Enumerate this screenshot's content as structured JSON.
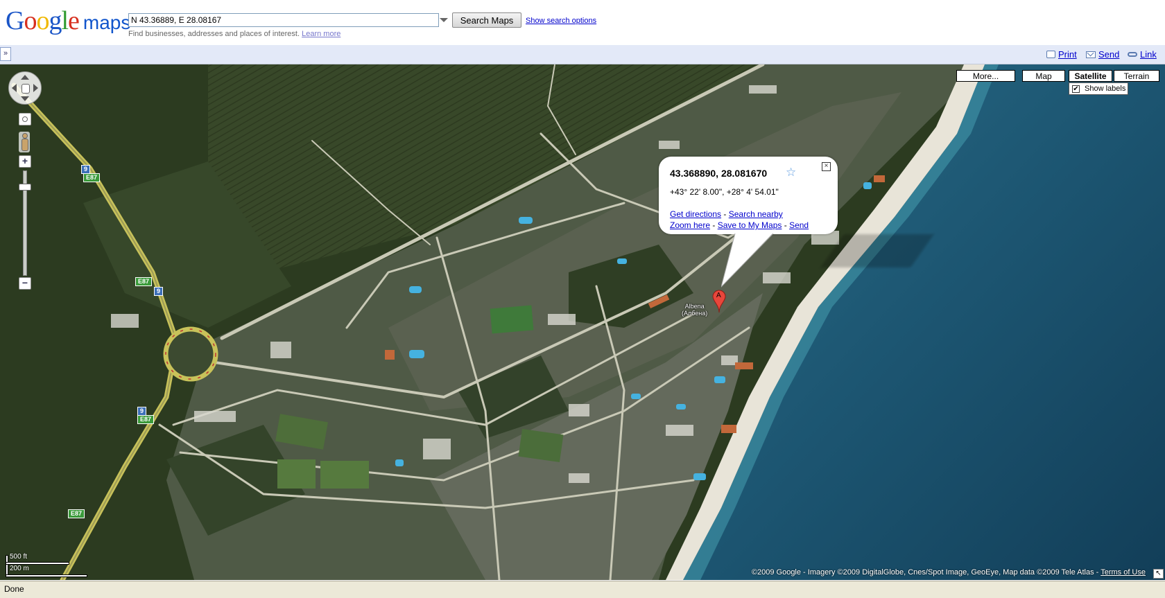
{
  "header": {
    "logo_google": "Google",
    "logo_maps": "maps",
    "search_value": "N 43.36889, E 28.08167",
    "search_button": "Search Maps",
    "search_options_link": "Show search options",
    "hint_text": "Find businesses, addresses and places of interest.",
    "hint_link": "Learn more"
  },
  "toolbar": {
    "panel_toggle": "»",
    "print": "Print",
    "send": "Send",
    "link": "Link"
  },
  "maptype": {
    "more": "More...",
    "map": "Map",
    "satellite": "Satellite",
    "terrain": "Terrain",
    "active": "Satellite",
    "labels_check": "✔",
    "labels_text": "Show labels",
    "labels_checked": true
  },
  "info_window": {
    "title": "43.368890, 28.081670",
    "star": "☆",
    "close": "×",
    "dms": "+43° 22' 8.00\", +28° 4' 54.01\"",
    "get_directions": "Get directions",
    "search_nearby": "Search nearby",
    "zoom_here": "Zoom here",
    "save_to_my_maps": "Save to My Maps",
    "send": "Send",
    "separator": " - "
  },
  "marker": {
    "label": "A",
    "color": "#e8463b"
  },
  "poi": {
    "name_line1": "Albena",
    "name_line2": "(Албена)"
  },
  "shields": [
    {
      "text": "9",
      "type": "b"
    },
    {
      "text": "E87",
      "type": "g"
    },
    {
      "text": "E87",
      "type": "g"
    },
    {
      "text": "9",
      "type": "b"
    },
    {
      "text": "9",
      "type": "b"
    },
    {
      "text": "E87",
      "type": "g"
    },
    {
      "text": "E87",
      "type": "g"
    }
  ],
  "scale": {
    "feet": "500 ft",
    "meters": "200 m"
  },
  "copyright": {
    "text": "©2009 Google - Imagery ©2009 DigitalGlobe, Cnes/Spot Image, GeoEye, Map data ©2009 Tele Atlas -",
    "terms": "Terms of Use"
  },
  "status_bar": {
    "text": "Done"
  },
  "colors": {
    "sea": "#1f5a78",
    "beach": "#e8e4d8",
    "forest": "#2e3d20",
    "road": "#c9c9b6",
    "highway": "#c8c25a"
  }
}
